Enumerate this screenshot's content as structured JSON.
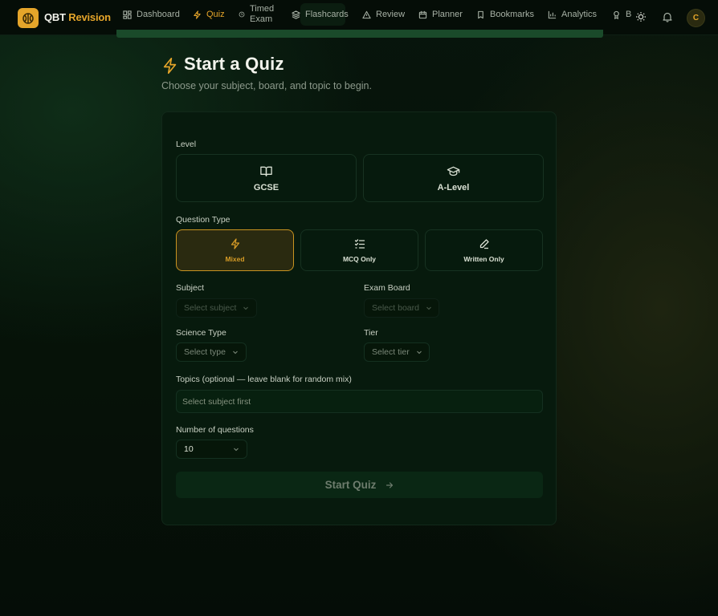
{
  "nav": {
    "brand_part1": "QBT",
    "brand_part2": "Revision",
    "items": [
      {
        "label": "Dashboard",
        "icon": "dashboard-icon"
      },
      {
        "label": "Quiz",
        "icon": "lightning-icon",
        "active": true
      },
      {
        "label": "Timed Exam",
        "icon": "timer-icon"
      },
      {
        "label": "Flashcards",
        "icon": "layers-icon"
      },
      {
        "label": "Review",
        "icon": "warning-icon"
      },
      {
        "label": "Planner",
        "icon": "calendar-icon"
      },
      {
        "label": "Bookmarks",
        "icon": "bookmark-icon"
      },
      {
        "label": "Analytics",
        "icon": "bar-chart-icon"
      },
      {
        "label": "B",
        "icon": "badge-icon"
      }
    ],
    "avatar_initial": "C"
  },
  "page": {
    "title": "Start a Quiz",
    "subtitle": "Choose your subject, board, and topic to begin."
  },
  "form": {
    "level_label": "Level",
    "levels": [
      {
        "label": "GCSE",
        "icon": "book-open-icon",
        "selected": false
      },
      {
        "label": "A-Level",
        "icon": "graduation-cap-icon",
        "selected": false
      }
    ],
    "question_type_label": "Question Type",
    "question_types": [
      {
        "label": "Mixed",
        "icon": "lightning-icon",
        "selected": true
      },
      {
        "label": "MCQ Only",
        "icon": "checklist-icon",
        "selected": false
      },
      {
        "label": "Written Only",
        "icon": "pen-icon",
        "selected": false
      }
    ],
    "subject_label": "Subject",
    "subject_placeholder": "Select subject",
    "board_label": "Exam Board",
    "board_placeholder": "Select board",
    "science_label": "Science Type",
    "science_placeholder": "Select type",
    "tier_label": "Tier",
    "tier_placeholder": "Select tier",
    "topics_label": "Topics (optional — leave blank for random mix)",
    "topics_placeholder": "Select subject first",
    "count_label": "Number of questions",
    "count_value": "10",
    "start_label": "Start Quiz"
  },
  "colors": {
    "accent": "#e5a52a",
    "background": "#06140a",
    "card": "#071a0d"
  }
}
